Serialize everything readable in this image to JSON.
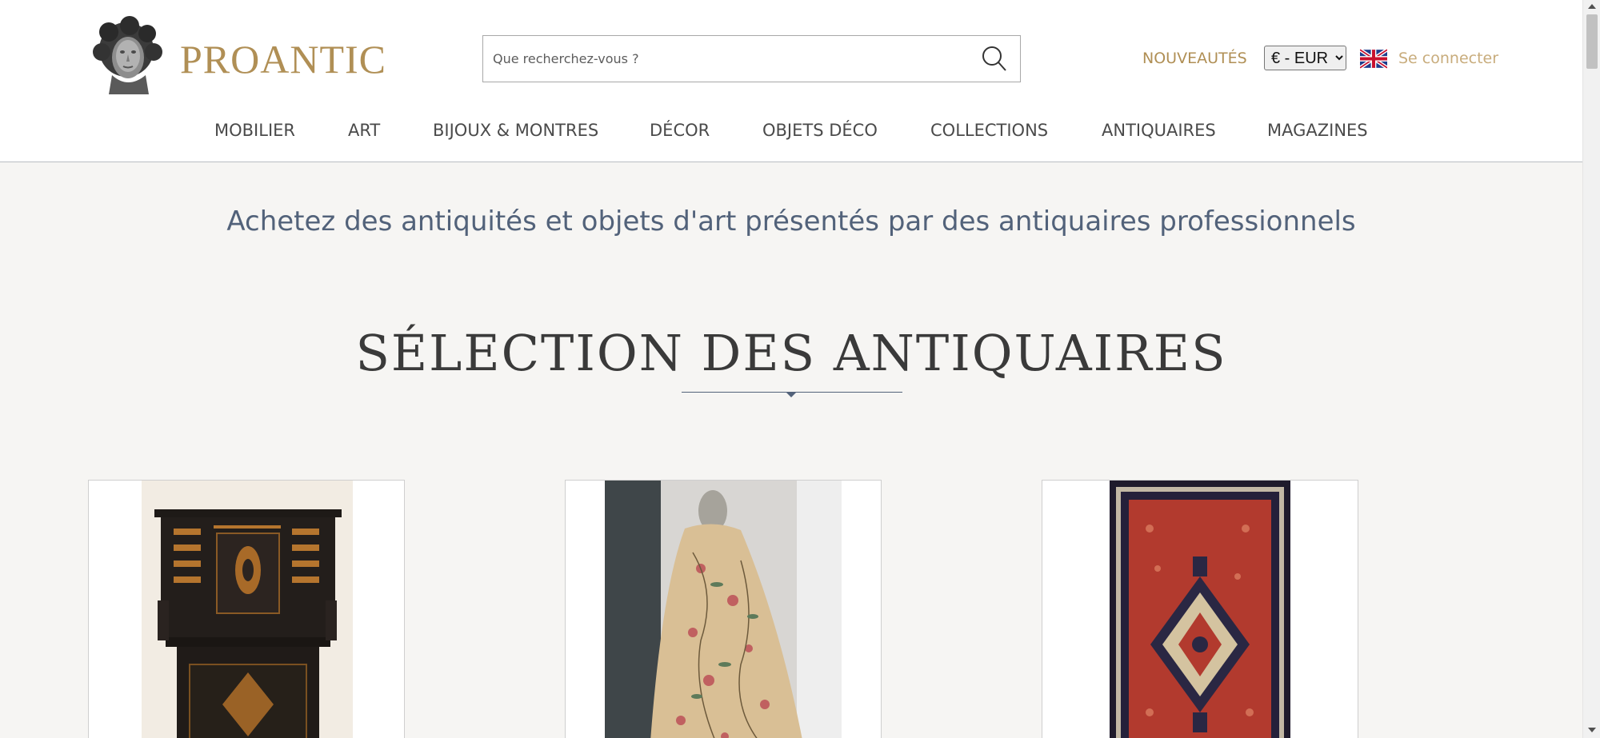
{
  "brand": {
    "name": "PROANTIC"
  },
  "search": {
    "placeholder": "Que recherchez-vous ?",
    "icon": "search-icon"
  },
  "header_links": {
    "new": "NOUVEAUTÉS",
    "currency_selected": "€ - EUR",
    "currency_options": [
      "€ - EUR"
    ],
    "language_icon": "uk-flag-icon",
    "login": "Se connecter"
  },
  "nav": [
    {
      "label": "MOBILIER"
    },
    {
      "label": "ART"
    },
    {
      "label": "BIJOUX & MONTRES"
    },
    {
      "label": "DÉCOR"
    },
    {
      "label": "OBJETS DÉCO"
    },
    {
      "label": "COLLECTIONS"
    },
    {
      "label": "ANTIQUAIRES"
    },
    {
      "label": "MAGAZINES"
    }
  ],
  "hero": {
    "tagline": "Achetez des antiquités et objets d'art présentés par des antiquaires professionnels"
  },
  "selection": {
    "title": "SÉLECTION DES ANTIQUAIRES"
  },
  "colors": {
    "gold": "#b08f55",
    "gold_light": "#c8ac7c",
    "slate": "#52627a",
    "page_bg": "#f6f5f3"
  }
}
